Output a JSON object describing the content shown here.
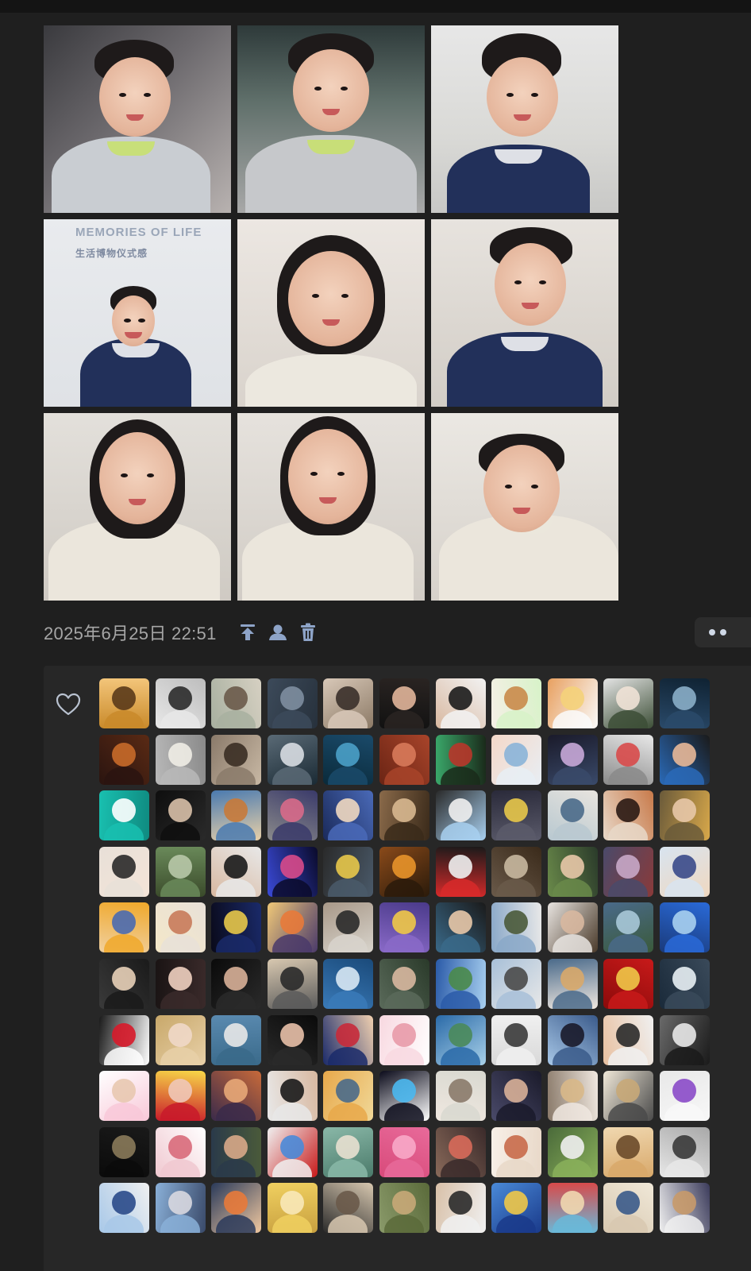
{
  "post": {
    "timestamp": "2025年6月25日 22:51",
    "photos": [
      {
        "name": "photo-1",
        "bg": "linear-gradient(135deg,#3a3a3e 0%,#6d6a6e 45%,#b8b2b0 100%)",
        "face": [
          70,
          40,
          90,
          100
        ],
        "hair": [
          64,
          18,
          100,
          55
        ],
        "body": [
          10,
          140,
          200,
          110
        ],
        "bodyColor": "#c9cdd2",
        "accent": "#c8e26a"
      },
      {
        "name": "photo-2",
        "bg": "linear-gradient(180deg,#2e3a3a 0%,#5f6f6a 40%,#a8a8a8 100%)",
        "face": [
          70,
          30,
          96,
          104
        ],
        "hair": [
          64,
          10,
          108,
          58
        ],
        "body": [
          10,
          138,
          216,
          110
        ],
        "bodyColor": "#c6c8cb",
        "accent": "#c8e26a"
      },
      {
        "name": "photo-3",
        "bg": "linear-gradient(180deg,#e7e7e7 0%,#d9d9d6 60%,#c8c8c6 100%)",
        "face": [
          70,
          40,
          90,
          100
        ],
        "hair": [
          64,
          10,
          100,
          62
        ],
        "body": [
          20,
          150,
          180,
          100
        ],
        "bodyColor": "#22305a",
        "accent": "#ffffff"
      },
      {
        "name": "photo-4",
        "bg": "linear-gradient(180deg,#e9ebee 0%,#dfe2e6 100%)",
        "face": [
          86,
          96,
          54,
          64
        ],
        "hair": [
          84,
          84,
          58,
          36
        ],
        "body": [
          46,
          150,
          140,
          100
        ],
        "bodyColor": "#22305a",
        "accent": "#ffffff",
        "wallTitle": "MEMORIES OF LIFE",
        "wallSub": "生活博物仪式感"
      },
      {
        "name": "photo-5",
        "bg": "linear-gradient(180deg,#ece7e2 0%,#d9d3cc 100%)",
        "face": [
          64,
          40,
          108,
          120
        ],
        "hair": [
          50,
          20,
          136,
          150
        ],
        "body": [
          10,
          170,
          216,
          90
        ],
        "bodyColor": "#ece8df",
        "accent": "#ece8df"
      },
      {
        "name": "photo-6",
        "bg": "linear-gradient(180deg,#e7e3de 0%,#d2cdc6 100%)",
        "face": [
          80,
          30,
          90,
          104
        ],
        "hair": [
          74,
          10,
          104,
          52
        ],
        "body": [
          20,
          142,
          196,
          110
        ],
        "bodyColor": "#22305a",
        "accent": "#ffffff"
      },
      {
        "name": "photo-7",
        "bg": "linear-gradient(180deg,#e3e0db 0%,#cfcac3 100%)",
        "face": [
          70,
          24,
          96,
          116
        ],
        "hair": [
          58,
          8,
          120,
          150
        ],
        "body": [
          6,
          134,
          216,
          110
        ],
        "bodyColor": "#ebe6dc",
        "accent": "#ebe6dc"
      },
      {
        "name": "photo-8",
        "bg": "linear-gradient(180deg,#e6e2dd 0%,#d1ccc5 100%)",
        "face": [
          64,
          20,
          100,
          120
        ],
        "hair": [
          54,
          4,
          120,
          150
        ],
        "body": [
          6,
          134,
          216,
          110
        ],
        "bodyColor": "#ebe6dc",
        "accent": "#ebe6dc"
      },
      {
        "name": "photo-9",
        "bg": "linear-gradient(180deg,#ebe8e3 0%,#d6d1ca 100%)",
        "face": [
          66,
          40,
          96,
          110
        ],
        "hair": [
          60,
          26,
          108,
          56
        ],
        "body": [
          10,
          128,
          226,
          120
        ],
        "bodyColor": "#ebe6dc",
        "accent": "#ebe6dc"
      }
    ]
  },
  "likes": {
    "avatars": [
      {
        "c": [
          "#c98a2a",
          "#5a3a1a",
          "#f3c57a"
        ]
      },
      {
        "c": [
          "#e8e8e8",
          "#2b2b2b",
          "#bdbdbd"
        ]
      },
      {
        "c": [
          "#a8b0a0",
          "#6a5a4a",
          "#d6d0c2"
        ]
      },
      {
        "c": [
          "#3c4a5a",
          "#7e8ea0",
          "#27313c"
        ]
      },
      {
        "c": [
          "#d8c8b8",
          "#3a302a",
          "#8c7a66"
        ]
      },
      {
        "c": [
          "#2a2422",
          "#e1b59a",
          "#111111"
        ]
      },
      {
        "c": [
          "#f2f2f2",
          "#1b1b1b",
          "#d8b8a0"
        ]
      },
      {
        "c": [
          "#d7f2c8",
          "#c98a4a",
          "#f5efe6"
        ]
      },
      {
        "c": [
          "#fafafa",
          "#f4d27a",
          "#e8a060"
        ]
      },
      {
        "c": [
          "#3c4e36",
          "#f0e2d6",
          "#e4e4e4"
        ]
      },
      {
        "c": [
          "#2a4a6a",
          "#8aaec8",
          "#0f2232"
        ]
      },
      {
        "c": [
          "#2a1410",
          "#c86a2a",
          "#5a2a14"
        ]
      },
      {
        "c": [
          "#b8b8b8",
          "#f0ede6",
          "#8a8a8a"
        ]
      },
      {
        "c": [
          "#8a7a6a",
          "#3a2e24",
          "#c8b8a4"
        ]
      },
      {
        "c": [
          "#5a6a76",
          "#d8dde2",
          "#1a2a34"
        ]
      },
      {
        "c": [
          "#1a4a6a",
          "#4aa0c8",
          "#0a2a3a"
        ]
      },
      {
        "c": [
          "#a8442a",
          "#d87a5a",
          "#6a2414"
        ]
      },
      {
        "c": [
          "#1a2a1a",
          "#b8362a",
          "#3aa86a"
        ]
      },
      {
        "c": [
          "#e8eef4",
          "#8ab4d8",
          "#f4d8c8"
        ]
      },
      {
        "c": [
          "#3a4a6a",
          "#c8a8d8",
          "#1a1a2a"
        ]
      },
      {
        "c": [
          "#8a8a8a",
          "#d84a4a",
          "#e8e8e8"
        ]
      },
      {
        "c": [
          "#2a6ab8",
          "#e8b898",
          "#1a1a1a"
        ]
      },
      {
        "c": [
          "#19c0b0",
          "#ffffff",
          "#0f8a80"
        ]
      },
      {
        "c": [
          "#0e0e0e",
          "#d8c0a8",
          "#2a2a2a"
        ]
      },
      {
        "c": [
          "#4a7ab0",
          "#c87a3a",
          "#e8d0a8"
        ]
      },
      {
        "c": [
          "#3a3a6a",
          "#d86a8a",
          "#8a8a8a"
        ]
      },
      {
        "c": [
          "#4a6ab8",
          "#f0d8c0",
          "#1a2a5a"
        ]
      },
      {
        "c": [
          "#3a2a1a",
          "#d8b890",
          "#8a6a4a"
        ]
      },
      {
        "c": [
          "#a8d0f0",
          "#f0f0f0",
          "#2a2a2a"
        ]
      },
      {
        "c": [
          "#5a5a6a",
          "#e8c84a",
          "#2a2a3a"
        ]
      },
      {
        "c": [
          "#b8c8d0",
          "#4a6a8a",
          "#e8e4de"
        ]
      },
      {
        "c": [
          "#e8d8c8",
          "#2a1a14",
          "#c87a4a"
        ]
      },
      {
        "c": [
          "#6a5a3a",
          "#e8c8a8",
          "#d8a84a"
        ]
      },
      {
        "c": [
          "#e8e0d8",
          "#2a2a2a",
          "#f4e4d8"
        ]
      },
      {
        "c": [
          "#6a8a5a",
          "#b8c8a8",
          "#3a4a2a"
        ]
      },
      {
        "c": [
          "#e8e8e8",
          "#1a1a1a",
          "#d8b8a0"
        ]
      },
      {
        "c": [
          "#0a0a2a",
          "#d84a8a",
          "#3a4ad8"
        ]
      },
      {
        "c": [
          "#4a5a6a",
          "#e8c84a",
          "#2a2a2a"
        ]
      },
      {
        "c": [
          "#2a1a0a",
          "#e8942a",
          "#8a4a1a"
        ]
      },
      {
        "c": [
          "#d82a2a",
          "#f0f0f0",
          "#1a1a1a"
        ]
      },
      {
        "c": [
          "#6a5a4a",
          "#c8b8a0",
          "#3a2a1a"
        ]
      },
      {
        "c": [
          "#6a8a4a",
          "#e8c8a8",
          "#2a3a2a"
        ]
      },
      {
        "c": [
          "#4a4a6a",
          "#c8a8c8",
          "#8a3a3a"
        ]
      },
      {
        "c": [
          "#d8e4f0",
          "#3a4a8a",
          "#f0d8c0"
        ]
      },
      {
        "c": [
          "#f0a82a",
          "#4a6ab0",
          "#f0d0a0"
        ]
      },
      {
        "c": [
          "#e8e0d8",
          "#c87a5a",
          "#f4e8c8"
        ]
      },
      {
        "c": [
          "#1a2a6a",
          "#e8c84a",
          "#0a0a1a"
        ]
      },
      {
        "c": [
          "#4a3a6a",
          "#e87a3a",
          "#f0c878"
        ]
      },
      {
        "c": [
          "#d8d4cc",
          "#2a2a2a",
          "#a89888"
        ]
      },
      {
        "c": [
          "#8a6ac8",
          "#f0c848",
          "#4a3a8a"
        ]
      },
      {
        "c": [
          "#3a6a8a",
          "#e8c8a8",
          "#1a1a1a"
        ]
      },
      {
        "c": [
          "#8aa8c8",
          "#4a5a3a",
          "#e8e8e8"
        ]
      },
      {
        "c": [
          "#e8e4e0",
          "#d8b8a0",
          "#4a3a2a"
        ]
      },
      {
        "c": [
          "#4a6a8a",
          "#a8c8d8",
          "#3a5a3a"
        ]
      },
      {
        "c": [
          "#2a6ad8",
          "#a8d0f0",
          "#1a3a7a"
        ]
      },
      {
        "c": [
          "#1a1a1a",
          "#e8d0b8",
          "#3a3a3a"
        ]
      },
      {
        "c": [
          "#3a2a2a",
          "#f0d0c0",
          "#1a1414"
        ]
      },
      {
        "c": [
          "#2a2a2a",
          "#d8b098",
          "#0a0a0a"
        ]
      },
      {
        "c": [
          "#5a5a5a",
          "#2a2a2a",
          "#d8c8b0"
        ]
      },
      {
        "c": [
          "#3a7ab8",
          "#d8e8f4",
          "#1a4a7a"
        ]
      },
      {
        "c": [
          "#5a6a5a",
          "#d8b8a0",
          "#2a3a2a"
        ]
      },
      {
        "c": [
          "#2a5aa8",
          "#4a8a4a",
          "#a8d0f0"
        ]
      },
      {
        "c": [
          "#a8c0d8",
          "#4a4a4a",
          "#e8e8e8"
        ]
      },
      {
        "c": [
          "#4a6a8a",
          "#d8a86a",
          "#f0e8e0"
        ]
      },
      {
        "c": [
          "#c81a1a",
          "#f0c848",
          "#8a0a0a"
        ]
      },
      {
        "c": [
          "#3a4a5a",
          "#e8f0f4",
          "#1a2a3a"
        ]
      },
      {
        "c": [
          "#ffffff",
          "#d81a2a",
          "#1a1a1a"
        ]
      },
      {
        "c": [
          "#e8d0a8",
          "#f0d8c8",
          "#c8a86a"
        ]
      },
      {
        "c": [
          "#3a6a8a",
          "#e8e8e8",
          "#5a8ab0"
        ]
      },
      {
        "c": [
          "#2a2a2a",
          "#e8c0a8",
          "#0a0a0a"
        ]
      },
      {
        "c": [
          "#1a2a6a",
          "#c82a3a",
          "#f0d0b0"
        ]
      },
      {
        "c": [
          "#f8d8e0",
          "#e89aa8",
          "#ffffff"
        ]
      },
      {
        "c": [
          "#2a6aa8",
          "#4a8a5a",
          "#a8d0e8"
        ]
      },
      {
        "c": [
          "#f0f0f0",
          "#3a3a3a",
          "#d8d8d8"
        ]
      },
      {
        "c": [
          "#3a5a8a",
          "#1a1a2a",
          "#a8c8e8"
        ]
      },
      {
        "c": [
          "#f0f0f0",
          "#2a2a2a",
          "#e8c0a0"
        ]
      },
      {
        "c": [
          "#1a1a1a",
          "#e8e8e8",
          "#6a6a6a"
        ]
      },
      {
        "c": [
          "#f8c8d8",
          "#e8c8b0",
          "#ffffff"
        ]
      },
      {
        "c": [
          "#c81a2a",
          "#f0c8b8",
          "#f8d848"
        ]
      },
      {
        "c": [
          "#3a2a4a",
          "#e8a878",
          "#c86a3a"
        ]
      },
      {
        "c": [
          "#e8e8e8",
          "#1a1a1a",
          "#d8b8a0"
        ]
      },
      {
        "c": [
          "#e8a84a",
          "#4a6a8a",
          "#f0d898"
        ]
      },
      {
        "c": [
          "#0a0a1a",
          "#4ab8f0",
          "#ffffff"
        ]
      },
      {
        "c": [
          "#d8d8d0",
          "#8a7a6a",
          "#f0e8e0"
        ]
      },
      {
        "c": [
          "#1a1a2a",
          "#d8b098",
          "#4a4a6a"
        ]
      },
      {
        "c": [
          "#f0e8e0",
          "#d8b888",
          "#8a7a6a"
        ]
      },
      {
        "c": [
          "#4a4a4a",
          "#c8a878",
          "#f0e8d8"
        ]
      },
      {
        "c": [
          "#f8f8f8",
          "#8a4ac8",
          "#e8e8e8"
        ]
      },
      {
        "c": [
          "#0a0a0a",
          "#8a7a5a",
          "#1a1a1a"
        ]
      },
      {
        "c": [
          "#f0c8d0",
          "#d86a7a",
          "#ffffff"
        ]
      },
      {
        "c": [
          "#2a3a4a",
          "#d8a888",
          "#4a5a3a"
        ]
      },
      {
        "c": [
          "#f0f0f0",
          "#4a8ad8",
          "#c81a1a"
        ]
      },
      {
        "c": [
          "#8ab8a8",
          "#e8e0d0",
          "#4a7a6a"
        ]
      },
      {
        "c": [
          "#e86a9a",
          "#f8a8c8",
          "#d84a7a"
        ]
      },
      {
        "c": [
          "#3a2a2a",
          "#d86a5a",
          "#8a6a5a"
        ]
      },
      {
        "c": [
          "#e8d8c8",
          "#c86a4a",
          "#f8f0e8"
        ]
      },
      {
        "c": [
          "#8ab05a",
          "#f0f0f0",
          "#4a6a3a"
        ]
      },
      {
        "c": [
          "#d8a86a",
          "#6a4a2a",
          "#f0d8b0"
        ]
      },
      {
        "c": [
          "#e8e8e8",
          "#3a3a3a",
          "#a8a8a8"
        ]
      },
      {
        "c": [
          "#a8c8e8",
          "#2a4a8a",
          "#f0f0f0"
        ]
      },
      {
        "c": [
          "#8ab0d8",
          "#d8d8e0",
          "#3a4a6a"
        ]
      },
      {
        "c": [
          "#2a3a5a",
          "#e87a3a",
          "#f0c8a0"
        ]
      },
      {
        "c": [
          "#f0d060",
          "#f8e8b8",
          "#c8a040"
        ]
      },
      {
        "c": [
          "#d8c8b0",
          "#6a5a4a",
          "#2a2a2a"
        ]
      },
      {
        "c": [
          "#5a6a3a",
          "#c8a878",
          "#8a9a6a"
        ]
      },
      {
        "c": [
          "#f0f0f0",
          "#2a2a2a",
          "#d8c0a8"
        ]
      },
      {
        "c": [
          "#1a3a8a",
          "#f0c848",
          "#4a8ad8"
        ]
      },
      {
        "c": [
          "#6ab8d8",
          "#f0d8b0",
          "#d84a4a"
        ]
      },
      {
        "c": [
          "#d8c8b0",
          "#3a5a8a",
          "#f0e8d8"
        ]
      },
      {
        "c": [
          "#f0f0f0",
          "#c89a6a",
          "#3a3a5a"
        ]
      }
    ]
  },
  "colors": {
    "icon": "#8ea4c8",
    "heart": "#b9c2d0"
  }
}
